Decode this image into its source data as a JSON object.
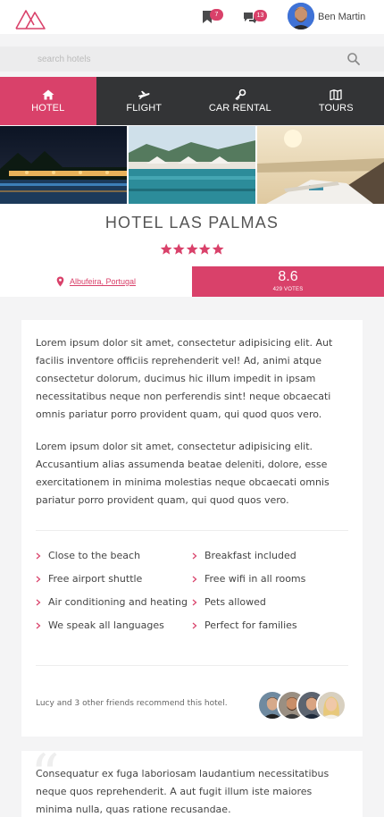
{
  "header": {
    "bookmark_count": "7",
    "message_count": "13",
    "user_name": "Ben Martin"
  },
  "search": {
    "placeholder": "search hotels"
  },
  "nav": {
    "tabs": [
      {
        "label": "HOTEL",
        "icon": "home-icon",
        "active": true
      },
      {
        "label": "FLIGHT",
        "icon": "plane-icon",
        "active": false
      },
      {
        "label": "CAR RENTAL",
        "icon": "key-icon",
        "active": false
      },
      {
        "label": "TOURS",
        "icon": "map-icon",
        "active": false
      }
    ]
  },
  "hotel": {
    "name": "HOTEL LAS PALMAS",
    "stars": 5,
    "location": "Albufeira, Portugal",
    "score": "8.6",
    "votes": "429 VOTES"
  },
  "description": {
    "paragraph_1": "Lorem ipsum dolor sit amet, consectetur adipisicing elit. Aut facilis inventore officiis reprehenderit vel! Ad, animi atque consectetur dolorum, ducimus hic illum impedit in ipsam necessitatibus neque non perferendis sint! neque obcaecati omnis pariatur porro provident quam, qui quod quos vero.",
    "paragraph_2": "Lorem ipsum dolor sit amet, consectetur adipisicing elit. Accusantium alias assumenda beatae deleniti, dolore, esse exercitationem in minima molestias neque obcaecati omnis pariatur porro provident quam, qui quod quos vero."
  },
  "features": [
    "Close to the beach",
    "Breakfast included",
    "Free airport shuttle",
    "Free wifi in all rooms",
    "Air conditioning and heating",
    "Pets allowed",
    "We speak all languages",
    "Perfect for families"
  ],
  "recommendation": {
    "text": "Lucy and 3 other friends recommend this hotel."
  },
  "review": {
    "text": "Consequatur ex fuga laboriosam laudantium necessitatibus neque quos reprehenderit. A aut fugit illum iste maiores minima nulla, quas ratione recusandae."
  },
  "colors": {
    "accent": "#d9416a",
    "nav_bg": "#333436"
  }
}
